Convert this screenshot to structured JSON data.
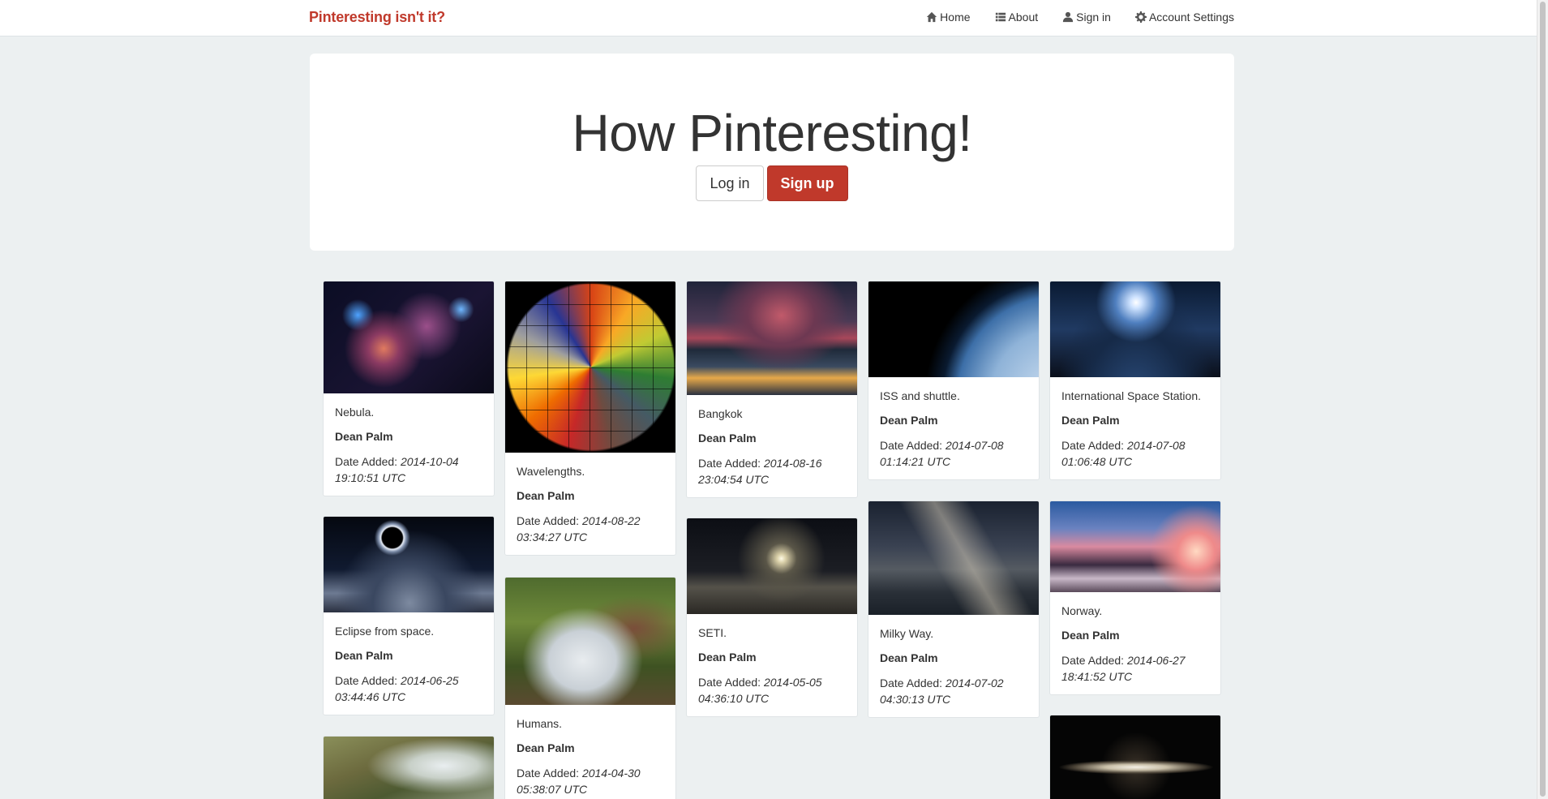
{
  "navbar": {
    "brand": "Pinteresting isn't it?",
    "links": [
      {
        "label": "Home",
        "icon": "home-icon"
      },
      {
        "label": "About",
        "icon": "list-icon"
      },
      {
        "label": "Sign in",
        "icon": "user-icon"
      },
      {
        "label": "Account Settings",
        "icon": "gear-icon"
      }
    ]
  },
  "hero": {
    "title": "How Pinteresting!",
    "login_label": "Log in",
    "signup_label": "Sign up"
  },
  "date_prefix": "Date Added:",
  "pins": [
    {
      "description": "Nebula.",
      "user": "Dean Palm",
      "date": "2014-10-04 19:10:51 UTC"
    },
    {
      "description": "Eclipse from space.",
      "user": "Dean Palm",
      "date": "2014-06-25 03:44:46 UTC"
    },
    {
      "description": "Wavelengths.",
      "user": "Dean Palm",
      "date": "2014-08-22 03:34:27 UTC"
    },
    {
      "description": "Humans.",
      "user": "Dean Palm",
      "date": "2014-04-30 05:38:07 UTC"
    },
    {
      "description": "Bangkok",
      "user": "Dean Palm",
      "date": "2014-08-16 23:04:54 UTC"
    },
    {
      "description": "SETI.",
      "user": "Dean Palm",
      "date": "2014-05-05 04:36:10 UTC"
    },
    {
      "description": "ISS and shuttle.",
      "user": "Dean Palm",
      "date": "2014-07-08 01:14:21 UTC"
    },
    {
      "description": "Milky Way.",
      "user": "Dean Palm",
      "date": "2014-07-02 04:30:13 UTC"
    },
    {
      "description": "International Space Station.",
      "user": "Dean Palm",
      "date": "2014-07-08 01:06:48 UTC"
    },
    {
      "description": "Norway.",
      "user": "Dean Palm",
      "date": "2014-06-27 18:41:52 UTC"
    }
  ]
}
